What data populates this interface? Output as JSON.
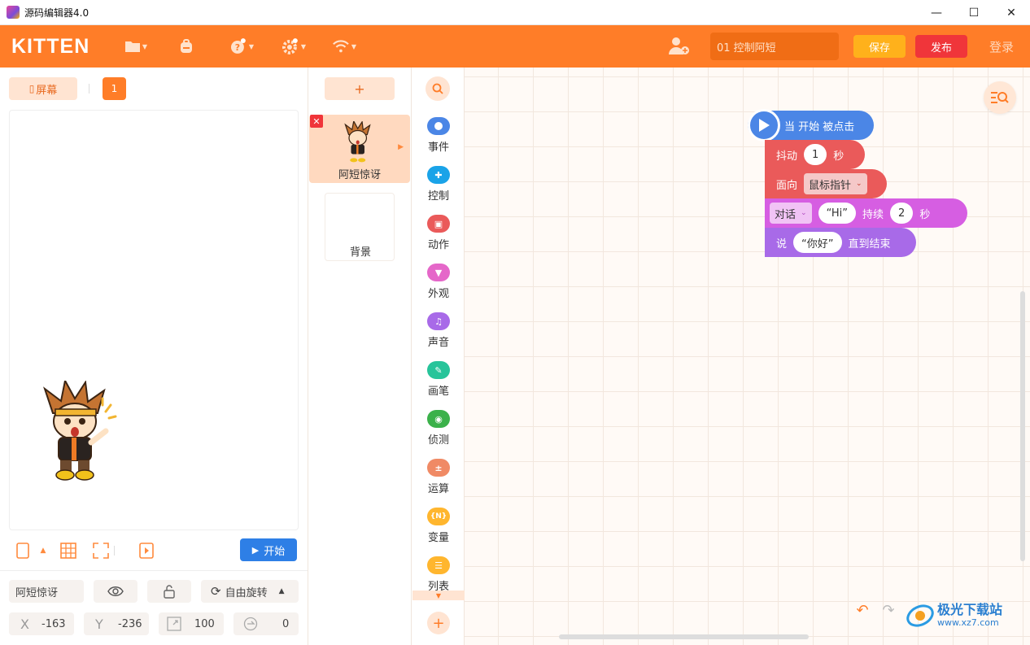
{
  "window": {
    "title": "源码编辑器4.0",
    "controls": [
      "—",
      "☐",
      "✕"
    ]
  },
  "header": {
    "logo": "KITTEN",
    "project_name": "01 控制阿短",
    "save_label": "保存",
    "publish_label": "发布",
    "login_label": "登录",
    "colors": {
      "accent": "#ff7d28",
      "save": "#ffb11b",
      "publish": "#f0353a"
    }
  },
  "stage": {
    "screen_label": "屏幕",
    "scene_number": "1",
    "start_label": "开始"
  },
  "sprite_props": {
    "name": "阿短惊讶",
    "rotation_mode": "自由旋转",
    "x_label": "X",
    "x": "-163",
    "y_label": "Y",
    "y": "-236",
    "size": "100",
    "direction": "0"
  },
  "sprites": {
    "add_label": "+",
    "items": [
      {
        "name": "阿短惊讶",
        "selected": true
      }
    ],
    "background_label": "背景"
  },
  "categories": [
    {
      "label": "事件",
      "color": "#4b86e6",
      "icon": "event-icon"
    },
    {
      "label": "控制",
      "color": "#1aa3e8",
      "icon": "control-icon"
    },
    {
      "label": "动作",
      "color": "#ea5a5a",
      "icon": "motion-icon"
    },
    {
      "label": "外观",
      "color": "#e567c9",
      "icon": "looks-icon"
    },
    {
      "label": "声音",
      "color": "#a86ae8",
      "icon": "sound-icon"
    },
    {
      "label": "画笔",
      "color": "#27c49a",
      "icon": "pen-icon"
    },
    {
      "label": "侦测",
      "color": "#3bb14a",
      "icon": "sensing-icon"
    },
    {
      "label": "运算",
      "color": "#f08a65",
      "icon": "operator-icon"
    },
    {
      "label": "变量",
      "color": "#ffb62e",
      "icon": "variable-icon"
    },
    {
      "label": "列表",
      "color": "#ffb62e",
      "icon": "list-icon"
    }
  ],
  "blocks": {
    "hat": "当 开始 被点击",
    "shake": {
      "label": "抖动",
      "value": "1",
      "unit": "秒"
    },
    "face": {
      "label": "面向",
      "option": "鼠标指针"
    },
    "dialog": {
      "option": "对话",
      "text": "“Hi”",
      "duration_label": "持续",
      "value": "2",
      "unit": "秒"
    },
    "say": {
      "label": "说",
      "text": "“你好”",
      "suffix": "直到结束"
    }
  },
  "watermark": {
    "text": "极光下载站",
    "url": "www.xz7.com"
  }
}
